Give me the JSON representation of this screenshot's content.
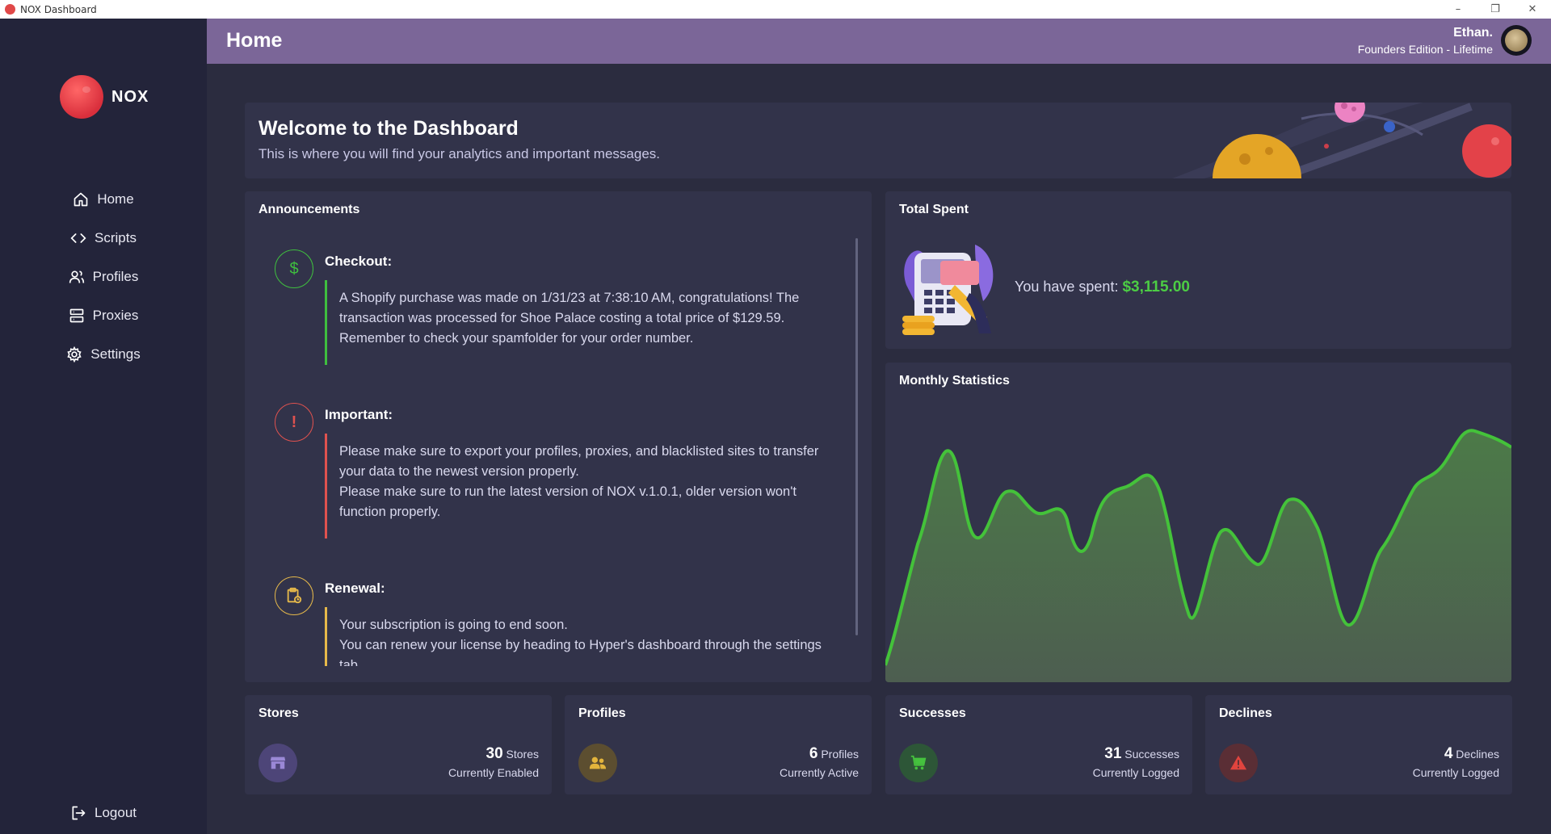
{
  "window": {
    "title": "NOX Dashboard",
    "minimize": "–",
    "maximize": "❐",
    "close": "✕"
  },
  "brand": {
    "name": "NOX"
  },
  "nav": {
    "items": [
      {
        "label": "Home",
        "icon": "home-icon"
      },
      {
        "label": "Scripts",
        "icon": "code-icon"
      },
      {
        "label": "Profiles",
        "icon": "users-icon"
      },
      {
        "label": "Proxies",
        "icon": "server-icon"
      },
      {
        "label": "Settings",
        "icon": "gear-icon"
      }
    ],
    "logout": "Logout"
  },
  "header": {
    "title": "Home",
    "user_name": "Ethan.",
    "user_plan": "Founders Edition - Lifetime"
  },
  "welcome": {
    "title": "Welcome to the Dashboard",
    "subtitle": "This is where you will find your analytics and important messages."
  },
  "announcements": {
    "title": "Announcements",
    "items": [
      {
        "title": "Checkout:",
        "icon": "dollar-icon",
        "color": "#3fbf3f",
        "paragraphs": [
          "A Shopify purchase was made on 1/31/23 at 7:38:10 AM, congratulations! The transaction was processed for Shoe Palace costing a total price of $129.59. Remember to check your spamfolder for your order number."
        ]
      },
      {
        "title": "Important:",
        "icon": "exclamation-icon",
        "color": "#e0524f",
        "paragraphs": [
          "Please make sure to export your profiles, proxies, and blacklisted sites to transfer your data to the newest version properly.",
          "Please make sure to run the latest version of NOX v.1.0.1, older version won't function properly."
        ]
      },
      {
        "title": "Renewal:",
        "icon": "clipboard-clock-icon",
        "color": "#e6b94a",
        "paragraphs": [
          "Your subscription is going to end soon.",
          "You can renew your license by heading to Hyper's dashboard through the settings tab."
        ]
      }
    ]
  },
  "total_spent": {
    "title": "Total Spent",
    "label": "You have spent:",
    "amount": "$3,115.00"
  },
  "monthly": {
    "title": "Monthly Statistics",
    "line_color": "#44c23a",
    "fill_color": "#4e6f4c"
  },
  "stats": {
    "stores": {
      "title": "Stores",
      "value": "30",
      "unit": "Stores",
      "sub": "Currently Enabled",
      "color": "#5a4f86",
      "icon_color": "#9a88d6"
    },
    "profiles": {
      "title": "Profiles",
      "value": "6",
      "unit": "Profiles",
      "sub": "Currently Active",
      "color": "#5f5134",
      "icon_color": "#e3b43c"
    },
    "successes": {
      "title": "Successes",
      "value": "31",
      "unit": "Successes",
      "sub": "Currently Logged",
      "color": "#2f5a3a",
      "icon_color": "#45c23e"
    },
    "declines": {
      "title": "Declines",
      "value": "4",
      "unit": "Declines",
      "sub": "Currently Logged",
      "color": "#5e2f35",
      "icon_color": "#e0443e"
    }
  }
}
